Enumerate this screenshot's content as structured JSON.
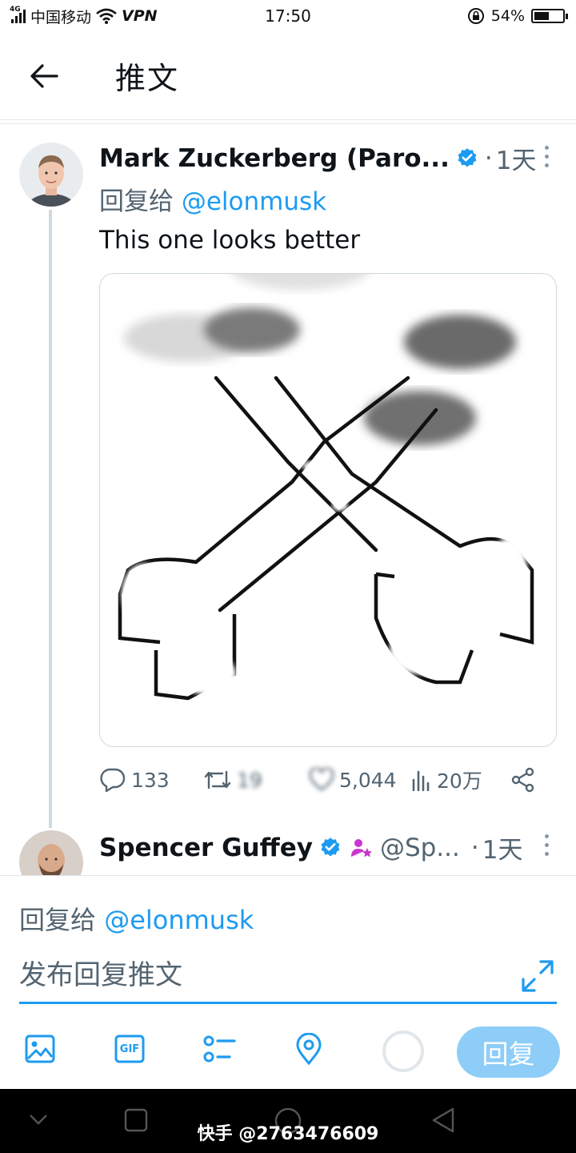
{
  "status_bar": {
    "network": "4G",
    "carrier": "中国移动",
    "vpn": "VPN",
    "time": "17:50",
    "battery": "54%",
    "battery_level": 0.54
  },
  "header": {
    "title": "推文",
    "back_icon": "arrow-left-icon"
  },
  "tweets": [
    {
      "author": "Mark Zuckerberg (Paro...",
      "time_sep": "·",
      "time": "1天",
      "reply_to_prefix": "回复给",
      "reply_to_handle": "@elonmusk",
      "text": "This one looks better",
      "stats": {
        "replies": "133",
        "retweets": "19",
        "likes": "5,044",
        "views": "20万"
      }
    },
    {
      "author": "Spencer Guffey",
      "handle": "@Sp...",
      "time_sep": "·",
      "time": "1天"
    }
  ],
  "composer": {
    "reply_to_prefix": "回复给",
    "reply_to_handle": "@elonmusk",
    "placeholder": "发布回复推文",
    "gif_label": "GIF",
    "reply_button": "回复",
    "tools": [
      "image-icon",
      "gif-icon",
      "poll-icon",
      "location-icon"
    ]
  },
  "watermark": "快手 @2763476609",
  "colors": {
    "accent": "#1d9bf0",
    "reply_button_disabled": "#8ecdf8",
    "secondary_text": "#536471",
    "purple_badge": "#c936d0"
  }
}
